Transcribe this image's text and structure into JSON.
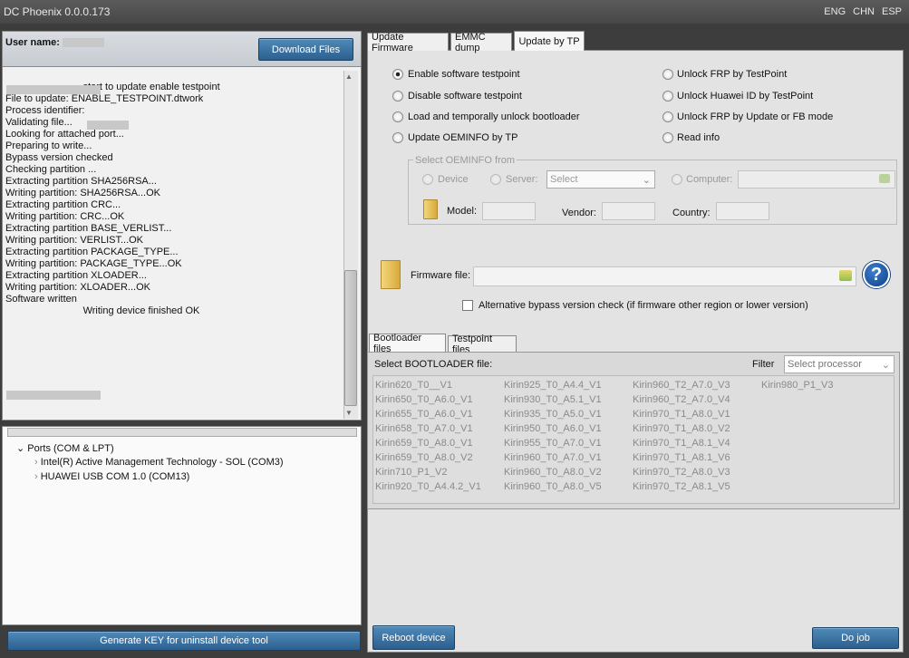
{
  "window": {
    "title": "DC Phoenix 0.0.0.173",
    "languages": [
      "ENG",
      "CHN",
      "ESP"
    ]
  },
  "left": {
    "user_label": "User name:",
    "download_button": "Download Files",
    "log_lines": [
      "start to update enable testpoint",
      "File to update: ENABLE_TESTPOINT.dtwork",
      "",
      "Process identifier:",
      "",
      "Validating file...",
      "Looking for attached port...",
      "Preparing to write...",
      "Bypass version checked",
      "Checking partition ...",
      "",
      "Extracting partition SHA256RSA...",
      "Writing partition: SHA256RSA...OK",
      "",
      "Extracting partition CRC...",
      "Writing partition: CRC...OK",
      "",
      "Extracting partition BASE_VERLIST...",
      "Writing partition: VERLIST...OK",
      "",
      "Extracting partition PACKAGE_TYPE...",
      "Writing partition: PACKAGE_TYPE...OK",
      "",
      "Extracting partition XLOADER...",
      "Writing partition: XLOADER...OK",
      "Software written",
      "Writing device finished OK"
    ],
    "tree": {
      "root": "Ports (COM & LPT)",
      "children": [
        "Intel(R) Active Management Technology - SOL (COM3)",
        "HUAWEI USB COM 1.0 (COM13)"
      ]
    },
    "generate_button": "Generate KEY for uninstall device tool"
  },
  "tabs": [
    "Update Firmware",
    "EMMC dump",
    "Update by TP"
  ],
  "options_left": [
    "Enable software testpoint",
    "Disable software testpoint",
    "Load and temporally unlock bootloader",
    "Update OEMINFO by TP"
  ],
  "options_right": [
    "Unlock FRP by TestPoint",
    "Unlock Huawei ID by TestPoint",
    "Unlock FRP by Update or FB mode",
    "Read info"
  ],
  "oeminfo": {
    "legend": "Select OEMINFO from",
    "device": "Device",
    "server": "Server:",
    "server_select": "Select",
    "computer": "Computer:",
    "model": "Model:",
    "vendor": "Vendor:",
    "country": "Country:"
  },
  "firmware": {
    "label": "Firmware file:",
    "help": "?",
    "alt_check": "Alternative bypass version check (if firmware other region or lower version)"
  },
  "subtabs": [
    "Bootloader files",
    "Testpoint files"
  ],
  "bootloader": {
    "select_label": "Select BOOTLOADER file:",
    "filter_label": "Filter",
    "filter_placeholder": "Select processor",
    "col1": [
      "Kirin620_T0__V1",
      "Kirin650_T0_A6.0_V1",
      "Kirin655_T0_A6.0_V1",
      "Kirin658_T0_A7.0_V1",
      "Kirin659_T0_A8.0_V1",
      "Kirin659_T0_A8.0_V2",
      "Kirin710_P1_V2",
      "Kirin920_T0_A4.4.2_V1"
    ],
    "col2": [
      "Kirin925_T0_A4.4_V1",
      "Kirin930_T0_A5.1_V1",
      "Kirin935_T0_A5.0_V1",
      "Kirin950_T0_A6.0_V1",
      "Kirin955_T0_A7.0_V1",
      "Kirin960_T0_A7.0_V1",
      "Kirin960_T0_A8.0_V2",
      "Kirin960_T0_A8.0_V5"
    ],
    "col3": [
      "Kirin960_T2_A7.0_V3",
      "Kirin960_T2_A7.0_V4",
      "Kirin970_T1_A8.0_V1",
      "Kirin970_T1_A8.0_V2",
      "Kirin970_T1_A8.1_V4",
      "Kirin970_T1_A8.1_V6",
      "Kirin970_T2_A8.0_V3",
      "Kirin970_T2_A8.1_V5"
    ],
    "col4": [
      "Kirin980_P1_V3"
    ]
  },
  "buttons": {
    "reboot": "Reboot device",
    "do_job": "Do job"
  }
}
